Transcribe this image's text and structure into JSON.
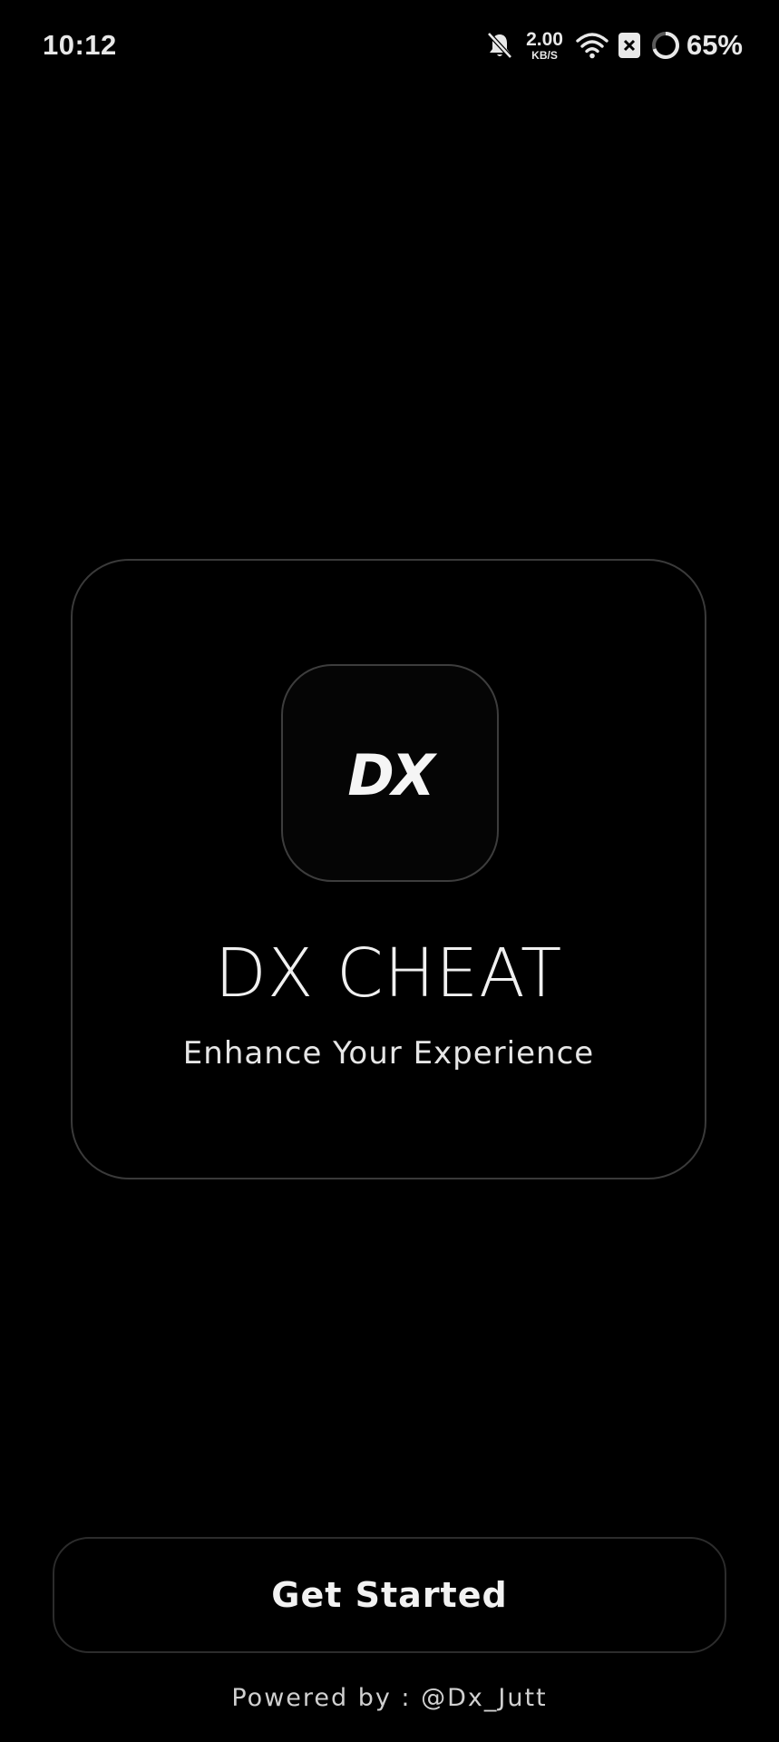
{
  "status_bar": {
    "time": "10:12",
    "net_speed_value": "2.00",
    "net_speed_unit": "KB/S",
    "battery_percent": "65%",
    "icons": [
      "bell-off-icon",
      "wifi-icon",
      "close-box-icon",
      "battery-ring-icon"
    ]
  },
  "hero": {
    "logo_text": "DX",
    "title": "DX CHEAT",
    "subtitle": "Enhance Your Experience"
  },
  "actions": {
    "get_started_label": "Get Started"
  },
  "footer": {
    "powered_by": "Powered by : @Dx_Jutt"
  },
  "colors": {
    "background": "#000000",
    "card_border": "#3a3a3a",
    "text_primary": "#f0f0f0"
  }
}
